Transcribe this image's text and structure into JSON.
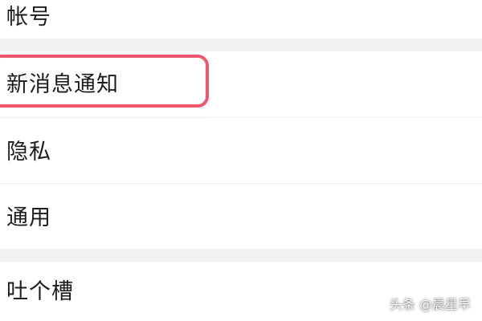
{
  "settings": {
    "items": [
      {
        "label": "帐号"
      },
      {
        "label": "新消息通知"
      },
      {
        "label": "隐私"
      },
      {
        "label": "通用"
      },
      {
        "label": "吐个槽"
      }
    ]
  },
  "highlight": {
    "target": "新消息通知",
    "color": "#f0566e"
  },
  "watermark": {
    "text": "头条 @晨星早"
  }
}
